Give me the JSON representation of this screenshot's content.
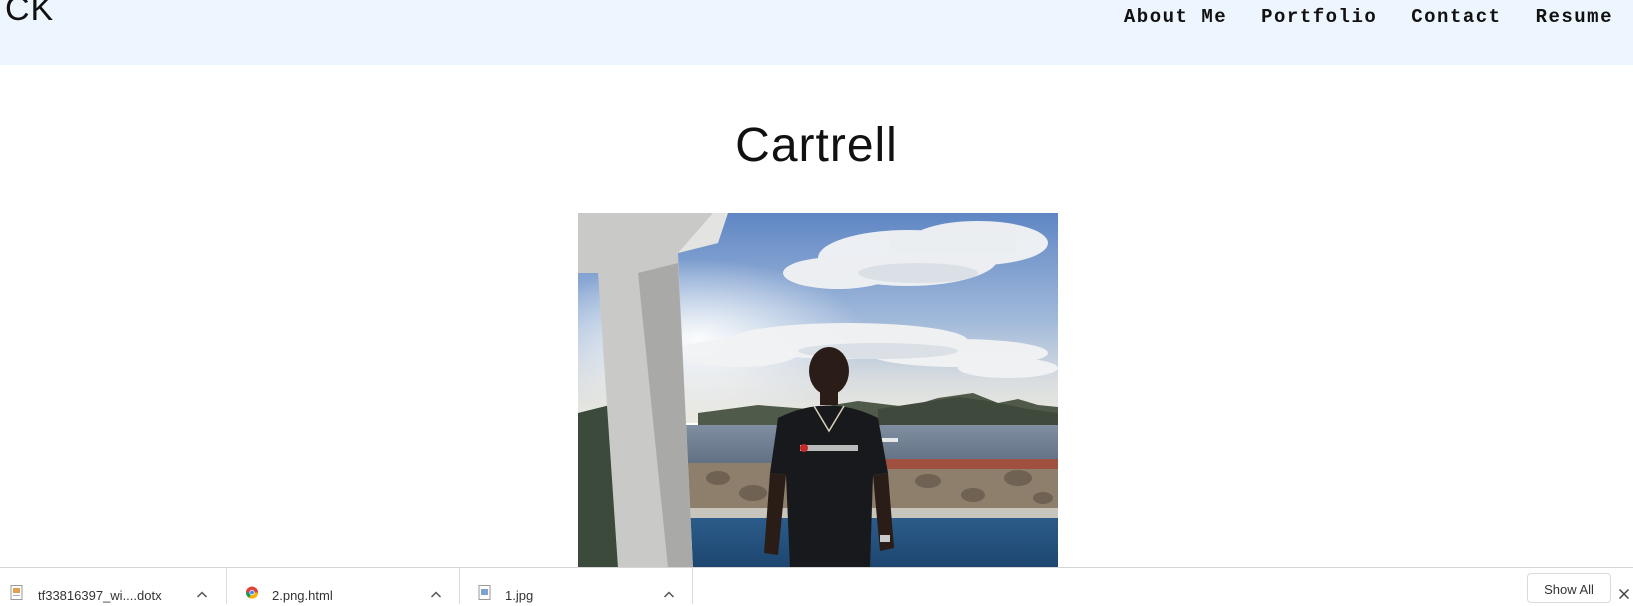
{
  "header": {
    "logo": "CK",
    "nav": [
      {
        "label": "About Me"
      },
      {
        "label": "Portfolio"
      },
      {
        "label": "Contact"
      },
      {
        "label": "Resume"
      }
    ],
    "background": "#edf5ff"
  },
  "main": {
    "title": "Cartrell"
  },
  "download_bar": {
    "items": [
      {
        "name": "tf33816397_wi....dotx",
        "icon": "document-icon"
      },
      {
        "name": "2.png.html",
        "icon": "chrome-icon"
      },
      {
        "name": "1.jpg",
        "icon": "image-file-icon"
      }
    ],
    "show_all_label": "Show All"
  }
}
